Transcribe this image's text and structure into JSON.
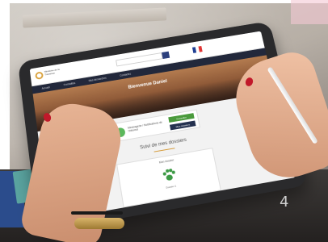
{
  "scene": {
    "description_tag": "",
    "number_mark": "4"
  },
  "tablet_ui": {
    "logo_text": "Ministère\nde la\nTransition",
    "search_placeholder": "",
    "top_right_text": "",
    "nav": {
      "items": [
        "Accueil",
        "Formalités",
        "Mes démarches",
        "Contactez"
      ]
    },
    "hero_title": "Bienvenue Daniel",
    "breadcrumb": "Accueil",
    "info_card": {
      "text": "Messagerie / Notifications de l'éleveur",
      "green_button": "Consulter",
      "dark_button": "Mes dossiers"
    },
    "section_title": "Suivi de mes dossiers",
    "dossier_card": {
      "label": "Mon dossier",
      "sub": "Dossier 1"
    }
  },
  "colors": {
    "nav": "#22283b",
    "accent_green": "#4a9a3c",
    "accent_dark": "#24314f",
    "nail": "#c1192a"
  }
}
